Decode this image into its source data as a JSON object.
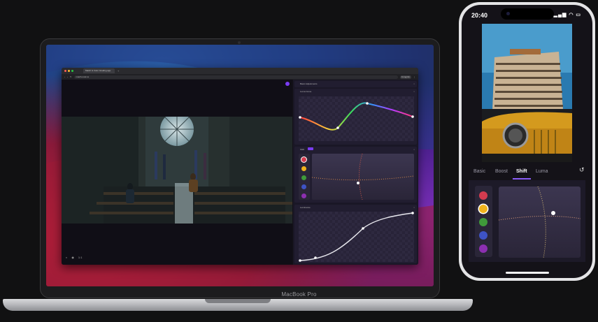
{
  "laptop": {
    "label": "MacBook Pro",
    "browser": {
      "tab_title": "Match & Color Grading app",
      "url": "match-color.io",
      "incognito_label": "Incognito",
      "traffic_lights": [
        "#ff5f57",
        "#febc2e",
        "#28c840"
      ]
    },
    "viewer": {
      "footer_icons": [
        "contrast-icon",
        "palette-icon"
      ],
      "footer_text": "1:1"
    },
    "panels": [
      {
        "title": "Basic Adjustments"
      },
      {
        "title": "Luma Curve"
      },
      {
        "title": "Shift"
      },
      {
        "title": "Luminance"
      }
    ]
  },
  "phone": {
    "status_time": "20:40",
    "status_icons": "▂▄▆ ◠ ▭",
    "tabs": [
      {
        "label": "Basic"
      },
      {
        "label": "Boost"
      },
      {
        "label": "Shift",
        "active": true
      },
      {
        "label": "Luma"
      }
    ],
    "reset_icon": "↺",
    "swatches": [
      "#d33b4f",
      "#f0b31c",
      "#3f9a3a",
      "#3e53c4",
      "#8c2fb0"
    ],
    "selected_swatch": 1
  },
  "colors": {
    "accent": "#7a3cf2",
    "background": "#111112"
  }
}
